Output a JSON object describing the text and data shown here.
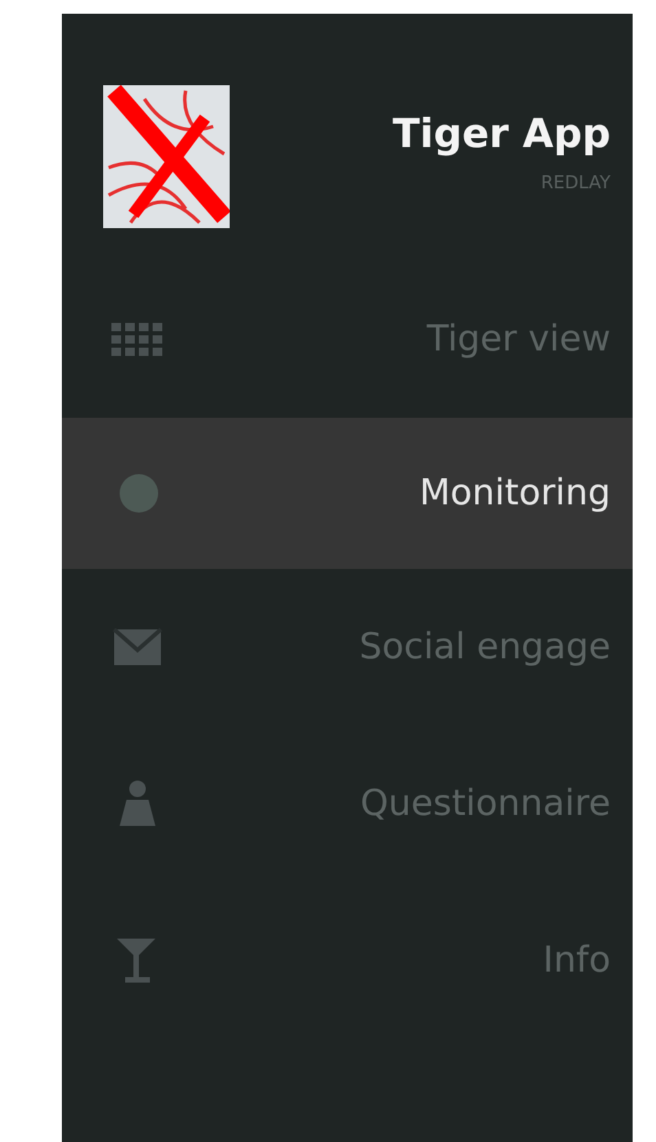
{
  "app": {
    "title": "Tiger App",
    "subtitle": "REDLAY"
  },
  "menu": [
    {
      "label": "Tiger view",
      "selected": false
    },
    {
      "label": "Monitoring",
      "selected": true
    },
    {
      "label": "Social engage",
      "selected": false
    },
    {
      "label": "Questionnaire",
      "selected": false
    },
    {
      "label": "Info",
      "selected": false
    }
  ]
}
